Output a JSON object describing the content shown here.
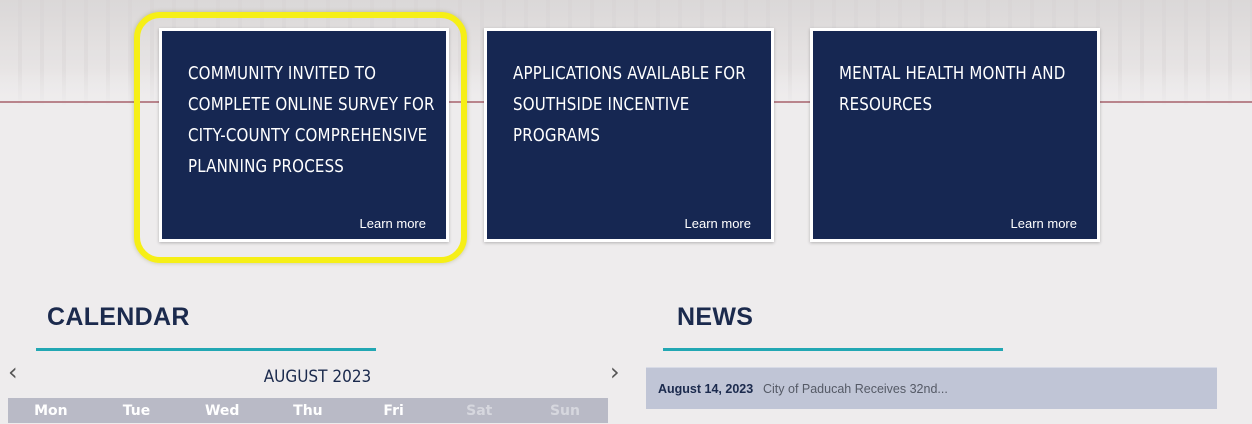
{
  "hero": {
    "cards": [
      {
        "title": "Community invited to complete online survey for city-county comprehensive planning process",
        "link": "Learn more"
      },
      {
        "title": "Applications available for Southside incentive programs",
        "link": "Learn more"
      },
      {
        "title": "Mental Health Month and resources",
        "link": "Learn more"
      }
    ],
    "highlight_color": "#f6ef16",
    "card_color": "#162752"
  },
  "calendar": {
    "title": "CALENDAR",
    "month": "AUGUST 2023",
    "prev_icon": "chevron-left-icon",
    "next_icon": "chevron-right-icon",
    "weekdays": [
      "Mon",
      "Tue",
      "Wed",
      "Thu",
      "Fri",
      "Sat",
      "Sun"
    ]
  },
  "news": {
    "title": "NEWS",
    "items": [
      {
        "date": "August 14, 2023",
        "headline": "City of Paducah Receives 32nd..."
      }
    ]
  },
  "colors": {
    "accent_teal": "#22a7b3",
    "heading_navy": "#1b2a4d",
    "rule_red": "#b9848c"
  }
}
